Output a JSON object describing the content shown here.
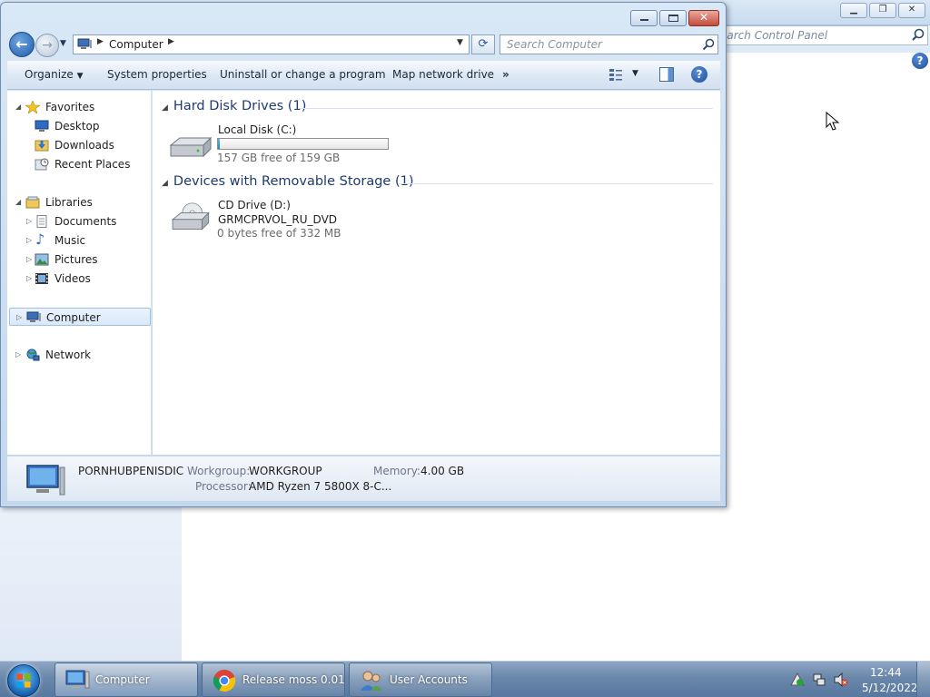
{
  "control_panel": {
    "search_placeholder": "Search Control Panel",
    "search_display": "earch Control Panel"
  },
  "explorer": {
    "address": {
      "crumb": "Computer"
    },
    "search_placeholder": "Search Computer",
    "toolbar": {
      "organize": "Organize",
      "system_properties": "System properties",
      "uninstall": "Uninstall or change a program",
      "map_drive": "Map network drive",
      "more": "»"
    },
    "nav": {
      "favorites": "Favorites",
      "desktop": "Desktop",
      "downloads": "Downloads",
      "recent_places": "Recent Places",
      "libraries": "Libraries",
      "documents": "Documents",
      "music": "Music",
      "pictures": "Pictures",
      "videos": "Videos",
      "computer": "Computer",
      "network": "Network"
    },
    "groups": {
      "hard_disk": "Hard Disk Drives (1)",
      "removable": "Devices with Removable Storage (1)"
    },
    "drives": {
      "local_disk": {
        "name": "Local Disk (C:)",
        "free": "157 GB free of 159 GB",
        "used_fraction": 0.0126
      },
      "cd_drive": {
        "name": "CD Drive (D:)",
        "label": "GRMCPRVOL_RU_DVD",
        "free": "0 bytes free of 332 MB"
      }
    },
    "details": {
      "computer_name": "PORNHUBPENISDIC",
      "workgroup_label": "Workgroup:",
      "workgroup": "WORKGROUP",
      "memory_label": "Memory:",
      "memory": "4.00 GB",
      "processor_label": "Processor:",
      "processor": "AMD Ryzen 7 5800X 8-C..."
    }
  },
  "taskbar": {
    "tasks": [
      "Computer",
      "Release moss 0.01...",
      "User Accounts"
    ],
    "time": "12:44",
    "date": "5/12/2022"
  },
  "colors": {
    "accent": "#1e3a6e",
    "disk_bar": "#1a86c9",
    "close_button": "#c44b3a"
  }
}
